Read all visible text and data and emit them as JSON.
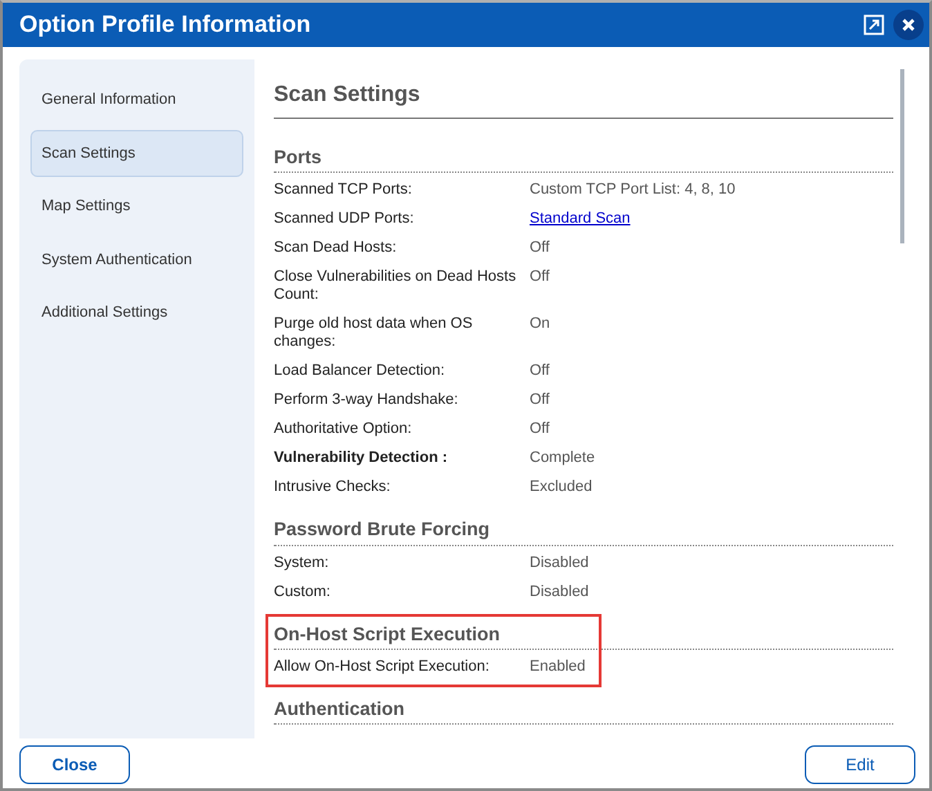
{
  "window": {
    "title": "Option Profile Information"
  },
  "sidebar": {
    "items": [
      {
        "label": "General Information",
        "selected": false
      },
      {
        "label": "Scan Settings",
        "selected": true
      },
      {
        "label": "Map Settings",
        "selected": false
      },
      {
        "label": "System Authentication",
        "selected": false
      },
      {
        "label": "Additional Settings",
        "selected": false
      }
    ]
  },
  "content": {
    "title": "Scan Settings",
    "sections": [
      {
        "title": "Ports",
        "highlighted": false,
        "rows": [
          {
            "label": "Scanned TCP Ports:",
            "value": "Custom TCP Port List: 4, 8, 10",
            "kind": "text",
            "bold": false
          },
          {
            "label": "Scanned UDP Ports:",
            "value": "Standard Scan",
            "kind": "link",
            "bold": false
          },
          {
            "label": "Scan Dead Hosts:",
            "value": "Off",
            "kind": "text",
            "bold": false
          },
          {
            "label": "Close Vulnerabilities on Dead Hosts Count:",
            "value": "Off",
            "kind": "text",
            "bold": false
          },
          {
            "label": "Purge old host data when OS changes:",
            "value": "On",
            "kind": "text",
            "bold": false
          },
          {
            "label": "Load Balancer Detection:",
            "value": "Off",
            "kind": "text",
            "bold": false
          },
          {
            "label": "Perform 3-way Handshake:",
            "value": "Off",
            "kind": "text",
            "bold": false
          },
          {
            "label": "Authoritative Option:",
            "value": "Off",
            "kind": "text",
            "bold": false
          },
          {
            "label": "Vulnerability Detection :",
            "value": "Complete",
            "kind": "text",
            "bold": true
          },
          {
            "label": "Intrusive Checks:",
            "value": "Excluded",
            "kind": "text",
            "bold": false
          }
        ]
      },
      {
        "title": "Password Brute Forcing",
        "highlighted": false,
        "rows": [
          {
            "label": "System:",
            "value": "Disabled",
            "kind": "text",
            "bold": false
          },
          {
            "label": "Custom:",
            "value": "Disabled",
            "kind": "text",
            "bold": false
          }
        ]
      },
      {
        "title": "On-Host Script Execution",
        "highlighted": true,
        "rows": [
          {
            "label": "Allow On-Host Script Execution:",
            "value": "Enabled",
            "kind": "text",
            "bold": false
          }
        ]
      },
      {
        "title": "Authentication",
        "highlighted": false
      }
    ]
  },
  "buttons": [
    {
      "label": "Close",
      "kind": "close"
    },
    {
      "label": "Edit",
      "kind": "edit"
    }
  ]
}
